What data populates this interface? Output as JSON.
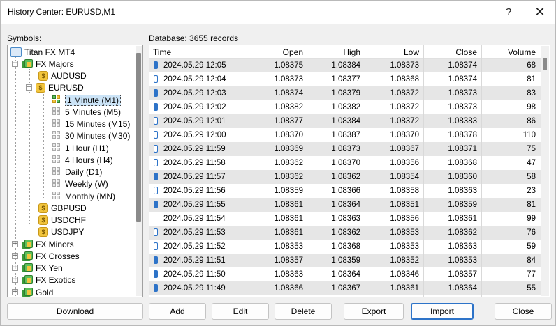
{
  "window": {
    "title": "History Center: EURUSD,M1",
    "help_glyph": "?",
    "close_glyph": "✕"
  },
  "symbols_label": "Symbols:",
  "database_label": "Database: 3655 records",
  "tree": {
    "root": "Titan FX MT4",
    "fx_majors": "FX Majors",
    "audusd": "AUDUSD",
    "eurusd": "EURUSD",
    "timeframes": [
      "1 Minute (M1)",
      "5 Minutes (M5)",
      "15 Minutes (M15)",
      "30 Minutes (M30)",
      "1 Hour (H1)",
      "4 Hours (H4)",
      "Daily (D1)",
      "Weekly (W)",
      "Monthly (MN)"
    ],
    "gbpusd": "GBPUSD",
    "usdchf": "USDCHF",
    "usdjpy": "USDJPY",
    "groups": [
      "FX Minors",
      "FX Crosses",
      "FX Yen",
      "FX Exotics",
      "Gold"
    ],
    "coin_glyph": "$",
    "plus": "+",
    "minus": "−"
  },
  "table": {
    "columns": [
      "Time",
      "Open",
      "High",
      "Low",
      "Close",
      "Volume"
    ],
    "rows": [
      [
        "2024.05.29 12:05",
        "1.08375",
        "1.08384",
        "1.08373",
        "1.08374",
        "68"
      ],
      [
        "2024.05.29 12:04",
        "1.08373",
        "1.08377",
        "1.08368",
        "1.08374",
        "81"
      ],
      [
        "2024.05.29 12:03",
        "1.08374",
        "1.08379",
        "1.08372",
        "1.08373",
        "83"
      ],
      [
        "2024.05.29 12:02",
        "1.08382",
        "1.08382",
        "1.08372",
        "1.08373",
        "98"
      ],
      [
        "2024.05.29 12:01",
        "1.08377",
        "1.08384",
        "1.08372",
        "1.08383",
        "86"
      ],
      [
        "2024.05.29 12:00",
        "1.08370",
        "1.08387",
        "1.08370",
        "1.08378",
        "110"
      ],
      [
        "2024.05.29 11:59",
        "1.08369",
        "1.08373",
        "1.08367",
        "1.08371",
        "75"
      ],
      [
        "2024.05.29 11:58",
        "1.08362",
        "1.08370",
        "1.08356",
        "1.08368",
        "47"
      ],
      [
        "2024.05.29 11:57",
        "1.08362",
        "1.08362",
        "1.08354",
        "1.08360",
        "58"
      ],
      [
        "2024.05.29 11:56",
        "1.08359",
        "1.08366",
        "1.08358",
        "1.08363",
        "23"
      ],
      [
        "2024.05.29 11:55",
        "1.08361",
        "1.08364",
        "1.08351",
        "1.08359",
        "81"
      ],
      [
        "2024.05.29 11:54",
        "1.08361",
        "1.08363",
        "1.08356",
        "1.08361",
        "99"
      ],
      [
        "2024.05.29 11:53",
        "1.08361",
        "1.08362",
        "1.08353",
        "1.08362",
        "76"
      ],
      [
        "2024.05.29 11:52",
        "1.08353",
        "1.08368",
        "1.08353",
        "1.08363",
        "59"
      ],
      [
        "2024.05.29 11:51",
        "1.08357",
        "1.08359",
        "1.08352",
        "1.08353",
        "84"
      ],
      [
        "2024.05.29 11:50",
        "1.08363",
        "1.08364",
        "1.08346",
        "1.08357",
        "77"
      ],
      [
        "2024.05.29 11:49",
        "1.08366",
        "1.08367",
        "1.08361",
        "1.08364",
        "55"
      ]
    ],
    "row_icons": [
      "filled",
      "hollow",
      "filled",
      "filled",
      "hollow",
      "hollow",
      "hollow",
      "hollow",
      "filled",
      "hollow",
      "filled",
      "tick",
      "hollow",
      "hollow",
      "filled",
      "filled",
      "filled"
    ]
  },
  "buttons": {
    "download": "Download",
    "add": "Add",
    "edit": "Edit",
    "delete": "Delete",
    "export": "Export",
    "import": "Import",
    "close": "Close"
  }
}
